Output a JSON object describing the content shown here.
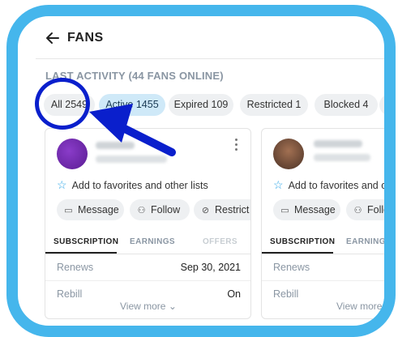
{
  "header": {
    "title": "FANS"
  },
  "subheading": "LAST ACTIVITY (44 FANS ONLINE)",
  "filters": [
    {
      "label": "All 2549",
      "active": false
    },
    {
      "label": "Active 1455",
      "active": true
    },
    {
      "label": "Expired 109",
      "active": false
    },
    {
      "label": "Restricted 1",
      "active": false
    },
    {
      "label": "Blocked 4",
      "active": false
    }
  ],
  "cards": [
    {
      "favorite_text": "Add to favorites and other lists",
      "buttons": {
        "message": "Message",
        "follow": "Follow",
        "restrict": "Restrict"
      },
      "tabs": {
        "subscription": "SUBSCRIPTION",
        "earnings": "EARNINGS",
        "offers": "OFFERS"
      },
      "rows": [
        {
          "label": "Renews",
          "value": "Sep 30, 2021"
        },
        {
          "label": "Rebill",
          "value": "On"
        }
      ],
      "view_more": "View more"
    },
    {
      "favorite_text": "Add to favorites and other lists",
      "buttons": {
        "message": "Message",
        "follow": "Follow"
      },
      "tabs": {
        "subscription": "SUBSCRIPTION",
        "earnings": "EARNINGS"
      },
      "rows": [
        {
          "label": "Renews",
          "value": ""
        },
        {
          "label": "Rebill",
          "value": ""
        }
      ],
      "view_more": "View more"
    }
  ],
  "annotation": {
    "circle_color": "#0a1fcc",
    "arrow_color": "#0a1fcc",
    "frame_color": "#45b6ec"
  },
  "colors": {
    "accent": "#2ea6e8",
    "active_chip": "#cfe9f8"
  }
}
